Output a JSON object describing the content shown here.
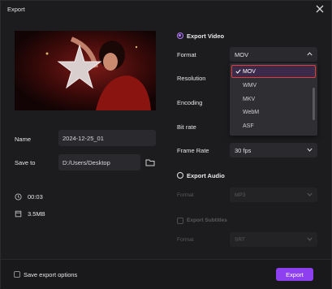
{
  "window": {
    "title": "Export"
  },
  "file": {
    "name_label": "Name",
    "name_value": "2024-12-25_01",
    "save_label": "Save to",
    "save_value": "D:/Users/Desktop"
  },
  "info": {
    "duration": "00:03",
    "size": "3.5MB"
  },
  "export_video": {
    "title": "Export Video",
    "format_label": "Format",
    "format_value": "MOV",
    "resolution_label": "Resolution",
    "encoding_label": "Encoding",
    "bitrate_label": "Bit rate",
    "framerate_label": "Frame Rate",
    "framerate_value": "30  fps",
    "format_options": [
      "MOV",
      "WMV",
      "MKV",
      "WebM",
      "ASF"
    ],
    "selected_option": "MOV"
  },
  "export_audio": {
    "title": "Export Audio",
    "format_label": "Format",
    "format_value": "MP3"
  },
  "export_subtitles": {
    "title": "Export Subtitles",
    "format_label": "Format",
    "format_value": "SRT"
  },
  "footer": {
    "save_options_label": "Save export options",
    "export_label": "Export"
  },
  "colors": {
    "accent": "#8e3ff0",
    "highlight_border": "#e03c3c",
    "background": "#1c1c1f"
  }
}
